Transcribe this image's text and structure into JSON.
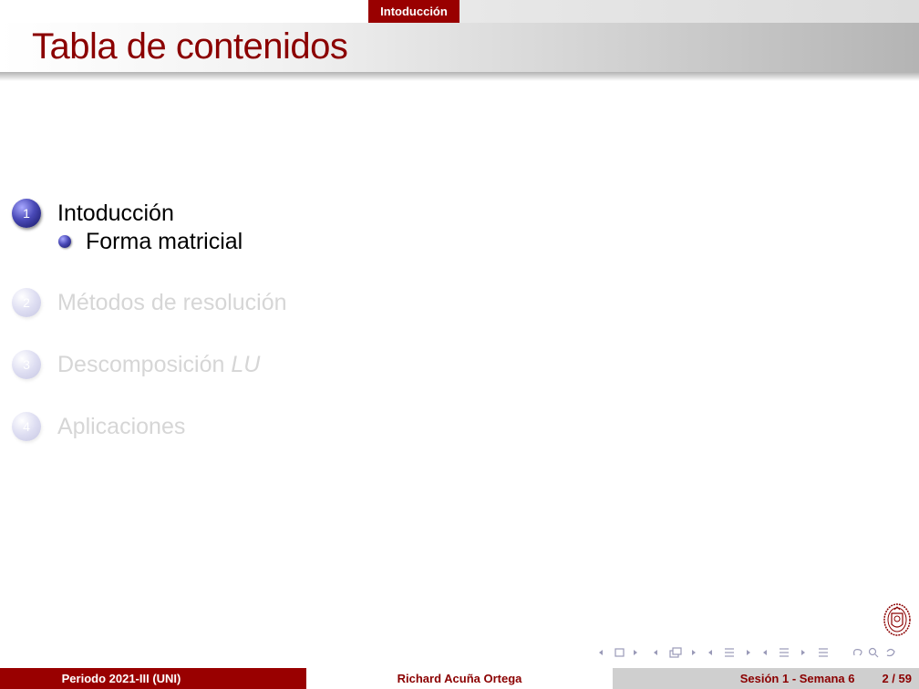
{
  "header": {
    "section": "Intoducción"
  },
  "frame": {
    "title": "Tabla de contenidos"
  },
  "toc": {
    "sections": [
      {
        "number": "1",
        "label": "Intoducción",
        "active": true
      },
      {
        "number": "2",
        "label": "Métodos de resolución",
        "active": false
      },
      {
        "number": "3",
        "label": "Descomposición ",
        "label_italic": "LU",
        "active": false
      },
      {
        "number": "4",
        "label": "Aplicaciones",
        "active": false
      }
    ],
    "subsections": [
      {
        "label": "Forma matricial"
      }
    ]
  },
  "footer": {
    "left": "Periodo 2021-III  (UNI)",
    "center": "Richard Acuña Ortega",
    "right": "Sesión 1 - Semana 6",
    "page": "2 / 59"
  },
  "colors": {
    "accent": "#990000",
    "title": "#8b0000",
    "active_ball": "#4a4ab8",
    "inactive_text": "#d6d6d6"
  },
  "icons": [
    "frame-nav-icon",
    "subsection-nav-icon",
    "section-nav-icon",
    "document-nav-icon",
    "search-icon",
    "logo-seal-icon"
  ]
}
